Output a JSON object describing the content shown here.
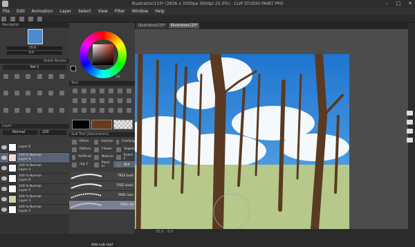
{
  "window": {
    "title": "Illustration133* (2836 x 3300px 300dpi 25.0%)  - CLIP STUDIO PAINT PRO"
  },
  "menu": [
    "File",
    "Edit",
    "Animation",
    "Layer",
    "Select",
    "View",
    "Filter",
    "Window",
    "Help"
  ],
  "panels": {
    "navigator_label": "Navigator",
    "navigator_zoom": "25.0",
    "navigator_angle": "0.0",
    "quick_access": "Quick Access",
    "set_label": "Set 1",
    "tool_label": "Tool",
    "subtool_label": "Sub Tool [Decoration]",
    "layer_label": "Layer",
    "blend_mode": "Normal",
    "opacity": "100",
    "color_values": [
      "41",
      "22",
      "14"
    ]
  },
  "subtool_groups": [
    [
      "Effect",
      "Hatchin",
      "Clothing"
    ],
    [
      "Pattern",
      "Flower",
      "Vegeta"
    ],
    [
      "Artificial",
      "Natural",
      "Ruled li"
    ],
    [
      "mg 3",
      "Plant ar",
      "樹木"
    ]
  ],
  "brushes": [
    "TREE bark",
    "TREE basic",
    "TREE leav",
    "TREE stil"
  ],
  "add_subtool": "Add sub tool",
  "layers": [
    {
      "mode": "",
      "name": "Layer 6",
      "selected": false,
      "thumb": "#ffffff"
    },
    {
      "mode": "100 % Normal",
      "name": "Layer 9",
      "selected": true,
      "thumb": "#f6dcdc"
    },
    {
      "mode": "100 % Normal",
      "name": "Layer 4",
      "selected": false,
      "thumb": "#ffffff"
    },
    {
      "mode": "100 % Normal",
      "name": "Layer 8",
      "selected": false,
      "thumb": "#ffffff"
    },
    {
      "mode": "100 % Normal",
      "name": "Layer 5",
      "selected": false,
      "thumb": "#ffffff"
    },
    {
      "mode": "100 % Normal",
      "name": "Layer 3",
      "selected": false,
      "thumb": "#c6d6a0"
    },
    {
      "mode": "100 % Normal",
      "name": "Layer 2",
      "selected": false,
      "thumb": "#ffffff"
    }
  ],
  "tabs": [
    "Illustration133*",
    "Illustration133*"
  ],
  "status": {
    "zoom": "25.0",
    "angle": "0.0"
  },
  "colors": {
    "sky": "#2f86d8",
    "grass": "#b6c98a",
    "trunk": "#5a3a22",
    "main_color": "#6a3a1e"
  }
}
